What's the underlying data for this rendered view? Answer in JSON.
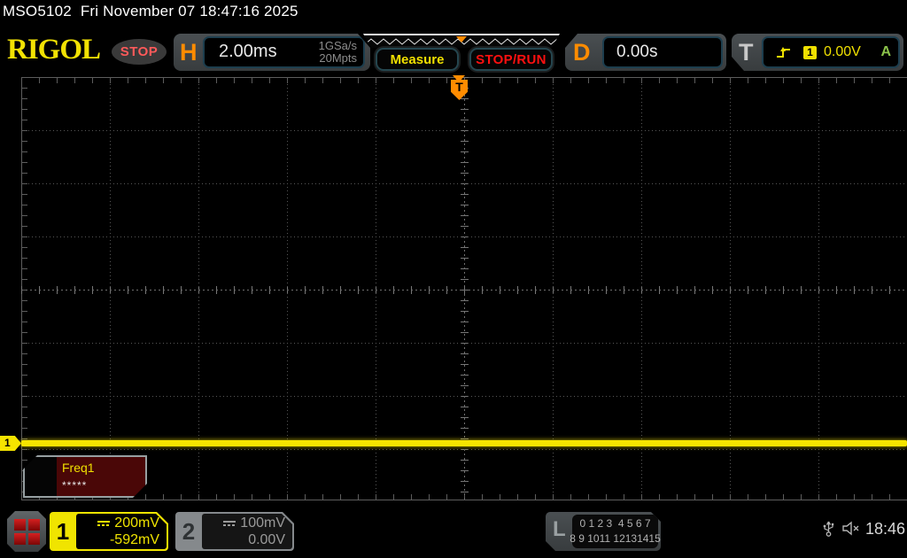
{
  "status_bar": {
    "model": "MSO5102",
    "datetime": "Fri November 07 18:47:16 2025"
  },
  "header": {
    "logo": "RIGOL",
    "run_state": "STOP",
    "horizontal": {
      "label": "H",
      "timebase": "2.00ms",
      "sample_rate": "1GSa/s",
      "memory_depth": "20Mpts"
    },
    "measure_button": "Measure",
    "stop_run_button": "STOP/RUN",
    "delay": {
      "label": "D",
      "value": "0.00s"
    },
    "trigger": {
      "label": "T",
      "source": "1",
      "level": "0.00V",
      "mode": "A"
    }
  },
  "grid": {
    "trigger_label": "T",
    "channel_marker": "1"
  },
  "measurement": {
    "name": "Freq1",
    "value": "*****"
  },
  "waveform": {
    "channel": 1,
    "shape": "flat-line",
    "offset_reading": "-592mV"
  },
  "footer": {
    "ch1": {
      "number": "1",
      "scale": "200mV",
      "offset": "-592mV"
    },
    "ch2": {
      "number": "2",
      "scale": "100mV",
      "offset": "0.00V"
    },
    "logic": {
      "label": "L",
      "row1": "0 1 2 3  4 5 6 7",
      "row2": "8 9 1011 12131415"
    },
    "clock": "18:46"
  },
  "colors": {
    "accent_orange": "#ff8c00",
    "channel1_yellow": "#f5e400",
    "channel2_gray": "#9a9a9a",
    "stop_red": "#ff5a5a",
    "stoprun_red": "#ff1010",
    "auto_green": "#8bc34a",
    "measure_box_maroon": "#4a0707"
  }
}
